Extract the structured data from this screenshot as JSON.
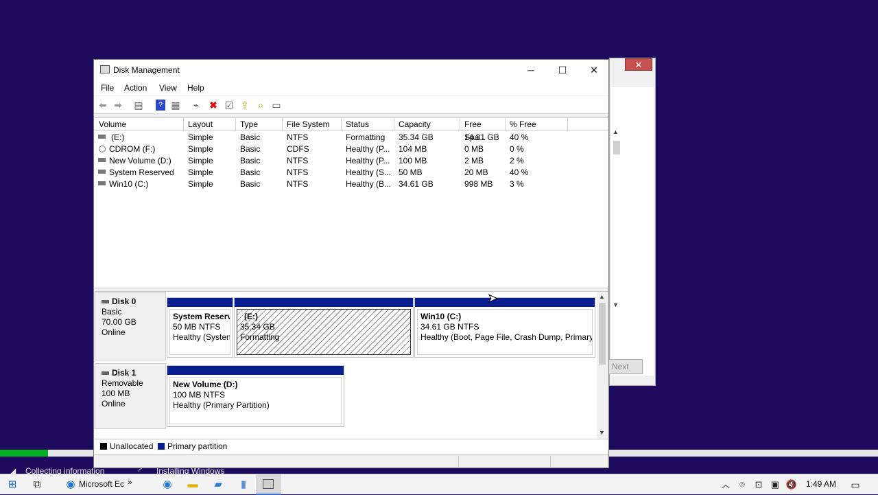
{
  "window": {
    "title": "Disk Management"
  },
  "window_controls": {
    "minimize": "─",
    "maximize": "☐",
    "close": "✕"
  },
  "menus": [
    "File",
    "Action",
    "View",
    "Help"
  ],
  "toolbar_icons": [
    "back-arrow-icon",
    "forward-arrow-icon",
    "console-tree-icon",
    "help-icon",
    "properties-icon",
    "connect-icon",
    "delete-icon",
    "check-icon",
    "upload-icon",
    "search-icon",
    "list-icon"
  ],
  "volume_table": {
    "columns": [
      "Volume",
      "Layout",
      "Type",
      "File System",
      "Status",
      "Capacity",
      "Free Spa...",
      "% Free"
    ],
    "rows": [
      [
        "(E:)",
        "Simple",
        "Basic",
        "NTFS",
        "Formatting",
        "35.34 GB",
        "14.31 GB",
        "40 %"
      ],
      [
        "CDROM (F:)",
        "Simple",
        "Basic",
        "CDFS",
        "Healthy (P...",
        "104 MB",
        "0 MB",
        "0 %"
      ],
      [
        "New Volume (D:)",
        "Simple",
        "Basic",
        "NTFS",
        "Healthy (P...",
        "100 MB",
        "2 MB",
        "2 %"
      ],
      [
        "System Reserved",
        "Simple",
        "Basic",
        "NTFS",
        "Healthy (S...",
        "50 MB",
        "20 MB",
        "40 %"
      ],
      [
        "Win10 (C:)",
        "Simple",
        "Basic",
        "NTFS",
        "Healthy (B...",
        "34.61 GB",
        "998 MB",
        "3 %"
      ]
    ]
  },
  "disks": [
    {
      "name": "Disk 0",
      "type": "Basic",
      "size": "70.00 GB",
      "state": "Online",
      "partitions": [
        {
          "name": "System Reserv",
          "size": "50 MB NTFS",
          "status": "Healthy (Systen"
        },
        {
          "name": "(E:)",
          "size": "35.34 GB",
          "status": "Formatting"
        },
        {
          "name": "Win10  (C:)",
          "size": "34.61 GB NTFS",
          "status": "Healthy (Boot, Page File, Crash Dump, Primary"
        }
      ]
    },
    {
      "name": "Disk 1",
      "type": "Removable",
      "size": "100 MB",
      "state": "Online",
      "partitions": [
        {
          "name": "New Volume  (D:)",
          "size": "100 MB NTFS",
          "status": "Healthy (Primary Partition)"
        }
      ]
    }
  ],
  "legend": {
    "unallocated": "Unallocated",
    "primary": "Primary partition"
  },
  "colors": {
    "primary_partition": "#0a1f8f",
    "unallocated": "#000000",
    "desktop": "#1e0a5c",
    "progress": "#06b025"
  },
  "background_window": {
    "next_button": "Next"
  },
  "background_status": {
    "left": "Collecting information",
    "right": "Installing Windows"
  },
  "taskbar": {
    "edge_label": "Microsoft Ec",
    "overflow": "»",
    "time": "1:49 AM"
  }
}
